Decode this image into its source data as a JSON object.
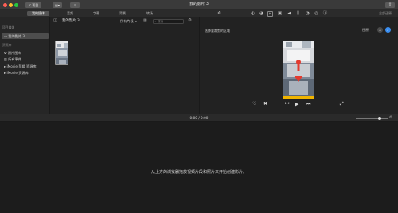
{
  "window": {
    "title": "我的影片 3"
  },
  "titlebar": {
    "back_label": "< 项目",
    "share_icon": "share-icon"
  },
  "tabs": [
    {
      "label": "我的媒体",
      "active": true
    },
    {
      "label": "音频",
      "active": false
    },
    {
      "label": "字幕",
      "active": false
    },
    {
      "label": "背景",
      "active": false
    },
    {
      "label": "转场",
      "active": false
    }
  ],
  "toolbar": {
    "reset_all": "全部还原"
  },
  "sidebar": {
    "section_project": "项目媒体",
    "project_item": "我的影片 3",
    "section_library": "资源库",
    "items": [
      {
        "label": "照片图库",
        "icon": "photos-icon"
      },
      {
        "label": "所有事件",
        "icon": "events-icon"
      },
      {
        "label": "iMovie 剪辑 资源库",
        "icon": "disclosure-icon"
      },
      {
        "label": "iMovie 资源库",
        "icon": "disclosure-icon"
      }
    ]
  },
  "browser": {
    "title": "我的影片 3",
    "filter_label": "所有片段",
    "search_placeholder": "搜索"
  },
  "viewer": {
    "crop_hint": "选择要裁剪的区域",
    "reset_label": "还原"
  },
  "timeline": {
    "timecode": "0:00 / 0:00",
    "hint": "从上方的浏览器拖放视频片段和照片来开始创建影片。"
  },
  "colors": {
    "accent": "#3a8ef0",
    "background": "#1e1e1e"
  }
}
